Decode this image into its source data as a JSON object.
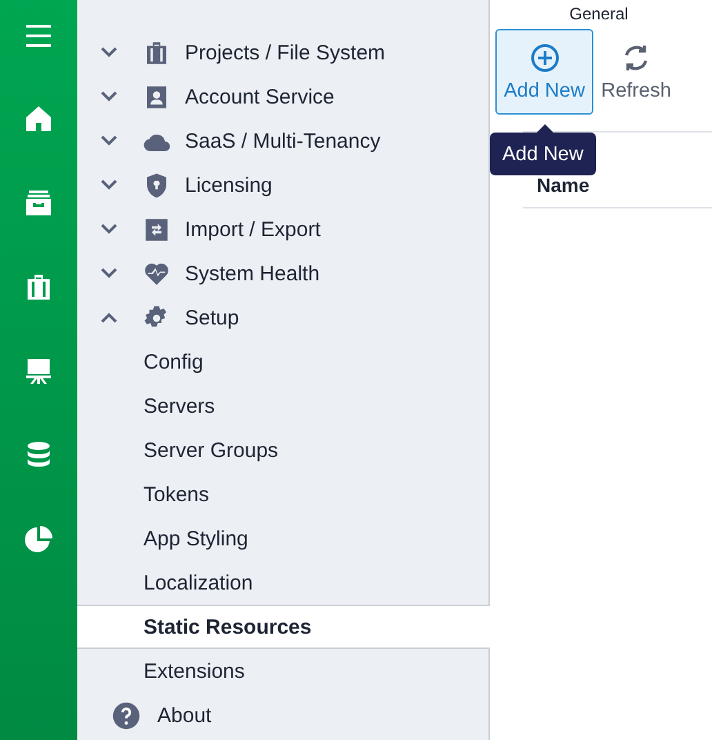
{
  "nav": {
    "groups": [
      {
        "label": "Projects / File System",
        "expanded": false
      },
      {
        "label": "Account Service",
        "expanded": false
      },
      {
        "label": "SaaS / Multi-Tenancy",
        "expanded": false
      },
      {
        "label": "Licensing",
        "expanded": false
      },
      {
        "label": "Import / Export",
        "expanded": false
      },
      {
        "label": "System Health",
        "expanded": false
      },
      {
        "label": "Setup",
        "expanded": true,
        "children": [
          {
            "label": "Config",
            "selected": false
          },
          {
            "label": "Servers",
            "selected": false
          },
          {
            "label": "Server Groups",
            "selected": false
          },
          {
            "label": "Tokens",
            "selected": false
          },
          {
            "label": "App Styling",
            "selected": false
          },
          {
            "label": "Localization",
            "selected": false
          },
          {
            "label": "Static Resources",
            "selected": true
          },
          {
            "label": "Extensions",
            "selected": false
          }
        ]
      }
    ],
    "about": {
      "label": "About"
    }
  },
  "toolbar": {
    "section": "General",
    "buttons": [
      {
        "label": "Add New",
        "selected": true
      },
      {
        "label": "Refresh",
        "selected": false
      }
    ],
    "tooltip": {
      "text": "Add New"
    }
  },
  "table": {
    "columns": [
      "Name"
    ]
  }
}
